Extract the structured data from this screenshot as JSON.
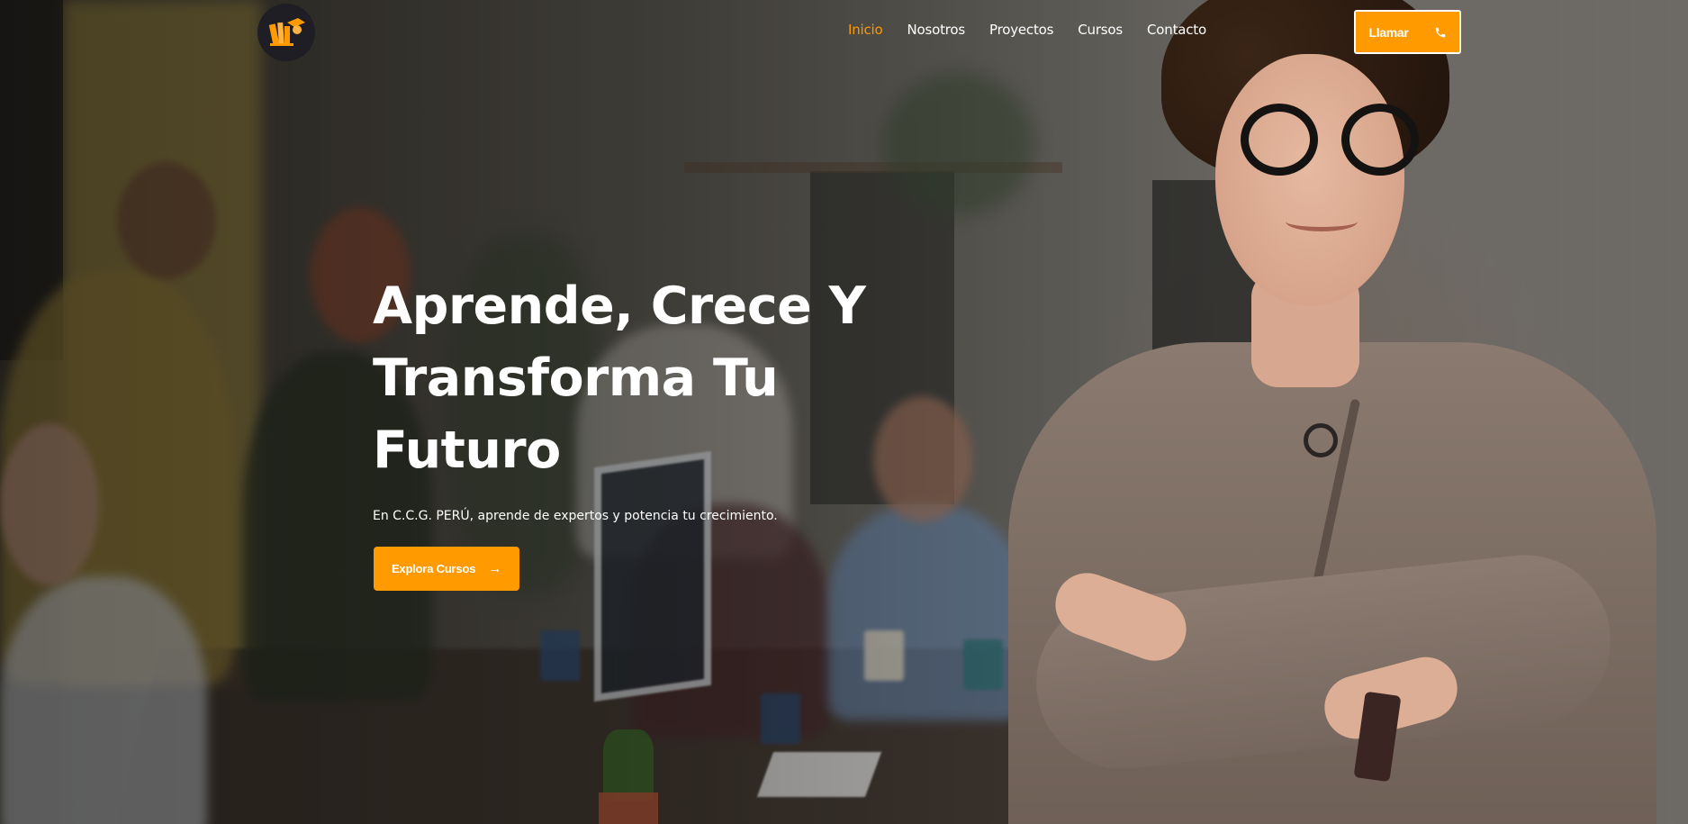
{
  "header": {
    "logo_icon": "books-graduation-icon",
    "nav": [
      {
        "label": "Inicio",
        "active": true
      },
      {
        "label": "Nosotros",
        "active": false
      },
      {
        "label": "Proyectos",
        "active": false
      },
      {
        "label": "Cursos",
        "active": false
      },
      {
        "label": "Contacto",
        "active": false
      }
    ],
    "call_button": {
      "label": "Llamar",
      "icon": "phone-icon"
    }
  },
  "hero": {
    "title_lines": [
      "Aprende, Crece Y",
      "Transforma Tu",
      "Futuro"
    ],
    "subtitle": "En C.C.G. PERÚ, aprende de expertos y potencia tu crecimiento.",
    "cta": {
      "label": "Explora Cursos",
      "icon": "arrow-right-icon",
      "arrow": "→"
    }
  },
  "colors": {
    "accent": "#ff9a00",
    "nav_active": "#ff9900",
    "text": "#ffffff",
    "logo_bg": "#1e1e24"
  }
}
